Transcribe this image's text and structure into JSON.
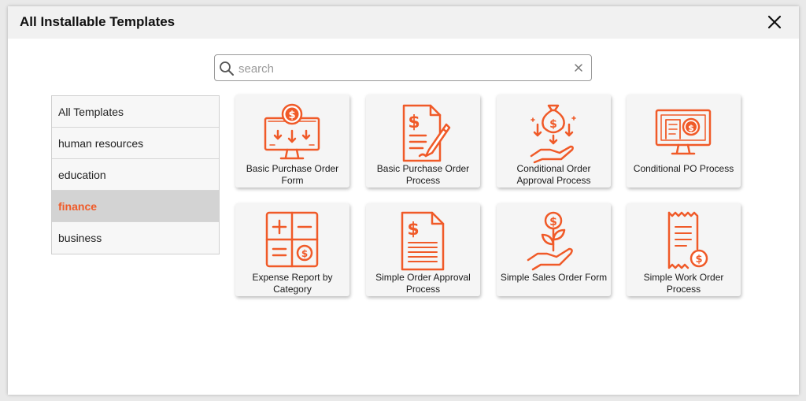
{
  "dialog": {
    "title": "All Installable Templates"
  },
  "search": {
    "placeholder": "search",
    "value": ""
  },
  "categories": [
    {
      "label": "All Templates",
      "active": false
    },
    {
      "label": "human resources",
      "active": false
    },
    {
      "label": "education",
      "active": false
    },
    {
      "label": "finance",
      "active": true
    },
    {
      "label": "business",
      "active": false
    }
  ],
  "templates": [
    {
      "label": "Basic Purchase Order Form",
      "icon": "monitor-dollar-icon"
    },
    {
      "label": "Basic Purchase Order Process",
      "icon": "document-pen-icon"
    },
    {
      "label": "Conditional Order Approval Process",
      "icon": "money-bag-hand-icon"
    },
    {
      "label": "Conditional PO Process",
      "icon": "monitor-invoice-icon"
    },
    {
      "label": "Expense Report by Category",
      "icon": "calculator-icon"
    },
    {
      "label": "Simple Order Approval Process",
      "icon": "invoice-document-icon"
    },
    {
      "label": "Simple Sales Order Form",
      "icon": "hand-plant-coin-icon"
    },
    {
      "label": "Simple Work Order Process",
      "icon": "receipt-coin-icon"
    }
  ],
  "colors": {
    "accent": "#f05a28",
    "active_category_bg": "#d3d3d3"
  }
}
